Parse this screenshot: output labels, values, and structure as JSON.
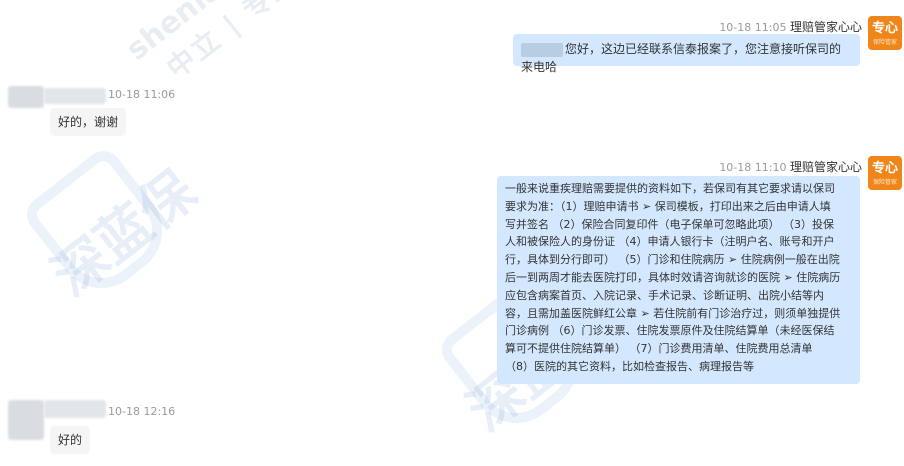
{
  "watermark": {
    "site": "shenlanbao.com",
    "slogan": "中立 | 专业 | 诚信",
    "logo_text": "深蓝保"
  },
  "messages": [
    {
      "side": "right",
      "sender": "理赔管家心心",
      "time": "10-18 11:05",
      "avatar_main": "专心",
      "avatar_sub": "保险管家",
      "text": "您好，这边已经联系信泰报案了，您注意接听保司的来电哈"
    },
    {
      "side": "left",
      "time": "10-18 11:06",
      "text": "好的，谢谢"
    },
    {
      "side": "right",
      "sender": "理赔管家心心",
      "time": "10-18 11:10",
      "avatar_main": "专心",
      "avatar_sub": "保险管家",
      "lines": [
        "一般来说重疾理赔需要提供的资料如下，若保司有其它要求请以保司",
        "要求为准：（1）理赔申请书 ➢ 保司模板，打印出来之后由申请人填",
        "写并签名 （2）保险合同复印件（电子保单可忽略此项） （3）投保",
        "人和被保险人的身份证 （4）申请人银行卡（注明户名、账号和开户",
        "行，具体到分行即可） （5）门诊和住院病历 ➢ 住院病例一般在出院",
        "后一到两周才能去医院打印，具体时效请咨询就诊的医院 ➢ 住院病历",
        "应包含病案首页、入院记录、手术记录、诊断证明、出院小结等内",
        "容，且需加盖医院鲜红公章 ➢ 若住院前有门诊治疗过，则须单独提供",
        "门诊病例 （6）门诊发票、住院发票原件及住院结算单（未经医保结",
        "算可不提供住院结算单） （7）门诊费用清单、住院费用总清单",
        " （8）医院的其它资料，比如检查报告、病理报告等"
      ]
    },
    {
      "side": "left",
      "time": "10-18 12:16",
      "text": "好的"
    }
  ]
}
